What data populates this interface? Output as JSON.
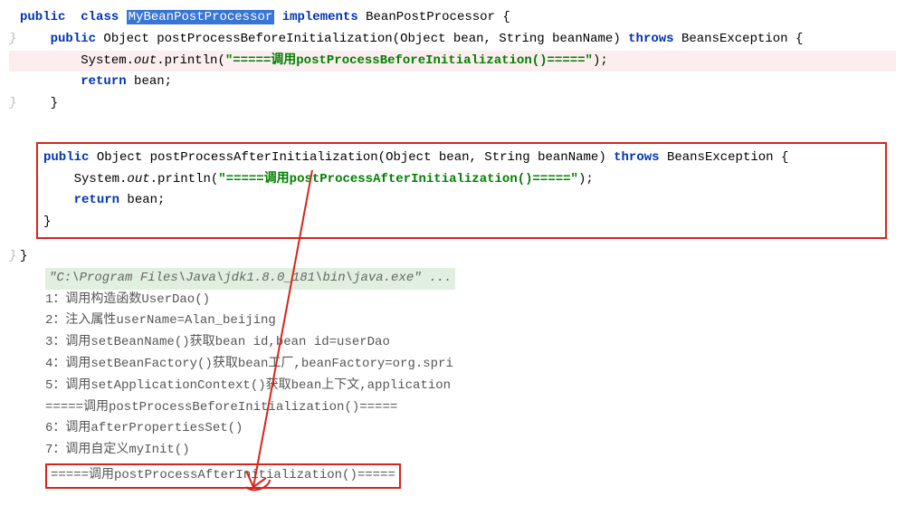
{
  "code": {
    "line1": {
      "public": "public",
      "class": "class",
      "className": "MyBeanPostProcessor",
      "implements": "implements",
      "interface": "BeanPostProcessor {"
    },
    "method1": {
      "sig_public": "public",
      "sig_rest": " Object postProcessBeforeInitialization(Object bean, String beanName) ",
      "throws": "throws",
      "exc": " BeansException {",
      "print_pre": "System.",
      "print_out": "out",
      "print_mid": ".println(",
      "print_str": "\"=====调用postProcessBeforeInitialization()=====\"",
      "print_post": ");",
      "return": "return",
      "ret_val": " bean;",
      "close": "}"
    },
    "method2": {
      "sig_public": "public",
      "sig_rest": " Object postProcessAfterInitialization(Object bean, String beanName) ",
      "throws": "throws",
      "exc": " BeansException {",
      "print_pre": "System.",
      "print_out": "out",
      "print_mid": ".println(",
      "print_str": "\"=====调用postProcessAfterInitialization()=====\"",
      "print_post": ");",
      "return": "return",
      "ret_val": " bean;",
      "close": "}"
    },
    "classClose": "}"
  },
  "output": {
    "hdr": "\"C:\\Program Files\\Java\\jdk1.8.0_181\\bin\\java.exe\" ...",
    "l1": "1：调用构造函数UserDao()",
    "l2": "2：注入属性userName=Alan_beijing",
    "l3": "3：调用setBeanName()获取bean id,bean id=userDao",
    "l4": "4：调用setBeanFactory()获取bean工厂,beanFactory=org.spri",
    "l5": "5：调用setApplicationContext()获取bean上下文,application",
    "l6": "=====调用postProcessBeforeInitialization()=====",
    "l7": "6：调用afterPropertiesSet()",
    "l8": "7：调用自定义myInit()",
    "l9": "=====调用postProcessAfterInitialization()====="
  }
}
